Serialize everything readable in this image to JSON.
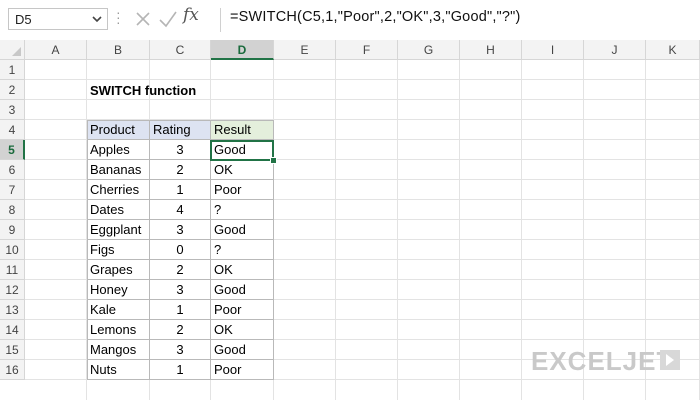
{
  "formula_bar": {
    "name_box": "D5",
    "formula": "=SWITCH(C5,1,\"Poor\",2,\"OK\",3,\"Good\",\"?\")",
    "fx_label": "fx"
  },
  "columns": [
    "A",
    "B",
    "C",
    "D",
    "E",
    "F",
    "G",
    "H",
    "I",
    "J",
    "K"
  ],
  "rows": [
    "1",
    "2",
    "3",
    "4",
    "5",
    "6",
    "7",
    "8",
    "9",
    "10",
    "11",
    "12",
    "13",
    "14",
    "15",
    "16"
  ],
  "selected_column": "D",
  "selected_row": "5",
  "title": "SWITCH function",
  "table": {
    "headers": [
      "Product",
      "Rating",
      "Result"
    ],
    "rows": [
      [
        "Apples",
        "3",
        "Good"
      ],
      [
        "Bananas",
        "2",
        "OK"
      ],
      [
        "Cherries",
        "1",
        "Poor"
      ],
      [
        "Dates",
        "4",
        "?"
      ],
      [
        "Eggplant",
        "3",
        "Good"
      ],
      [
        "Figs",
        "0",
        "?"
      ],
      [
        "Grapes",
        "2",
        "OK"
      ],
      [
        "Honey",
        "3",
        "Good"
      ],
      [
        "Kale",
        "1",
        "Poor"
      ],
      [
        "Lemons",
        "2",
        "OK"
      ],
      [
        "Mangos",
        "3",
        "Good"
      ],
      [
        "Nuts",
        "1",
        "Poor"
      ]
    ]
  },
  "watermark": "EXCELJET",
  "colors": {
    "selection": "#217346",
    "header_blue": "#dde3f2",
    "header_green": "#e4efdc"
  }
}
